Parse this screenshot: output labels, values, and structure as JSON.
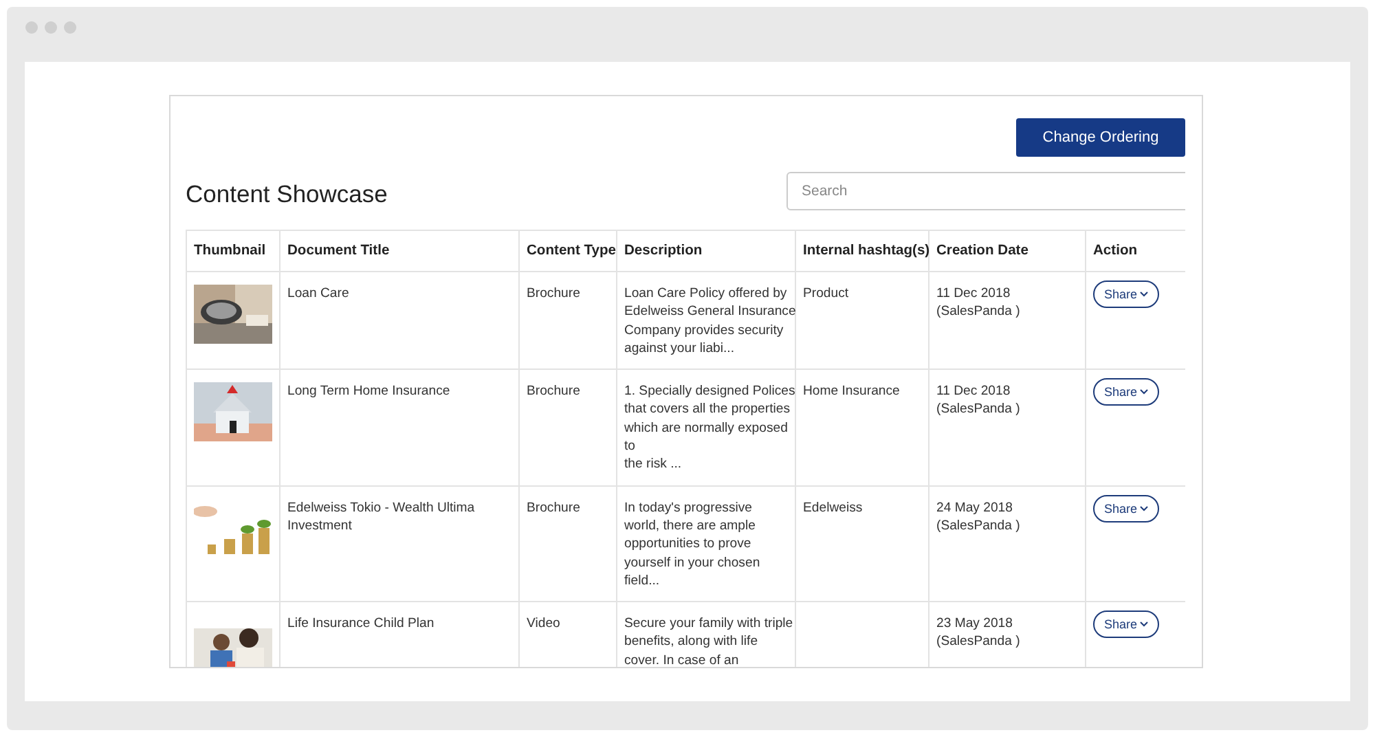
{
  "header": {
    "button": "Change Ordering",
    "title": "Content Showcase",
    "search": {
      "placeholder": "Search"
    }
  },
  "table": {
    "columns": [
      "Thumbnail",
      "Document Title",
      "Content Type",
      "Description",
      "Internal hashtag(s)",
      "Creation Date",
      "Action"
    ],
    "rows": [
      {
        "title": "Loan Care",
        "type": "Brochure",
        "description": "Loan Care Policy offered by\nEdelweiss General Insurance\nCompany provides security\nagainst your liabi...",
        "hashtag": "Product",
        "date": "11 Dec 2018",
        "author": "(SalesPanda )",
        "action": "Share"
      },
      {
        "title": "Long Term Home Insurance",
        "type": "Brochure",
        "description": "1. Specially designed Polices\nthat covers all the properties\nwhich are normally exposed\nto\nthe risk ...",
        "hashtag": "Home Insurance",
        "date": "11 Dec 2018",
        "author": "(SalesPanda )",
        "action": "Share"
      },
      {
        "title": "Edelweiss Tokio - Wealth Ultima\nInvestment",
        "type": "Brochure",
        "description": "In today's progressive\nworld, there are ample\nopportunities to prove\nyourself in your chosen\nfield...",
        "hashtag": "Edelweiss",
        "date": "24 May 2018",
        "author": "(SalesPanda )",
        "action": "Share"
      },
      {
        "title": "Life Insurance Child Plan",
        "type": "Video",
        "description": "Secure your family with triple\nbenefits, along with life\ncover. In case of an",
        "date": "23 May 2018",
        "author": "(SalesPanda )",
        "action": "Share"
      }
    ]
  }
}
